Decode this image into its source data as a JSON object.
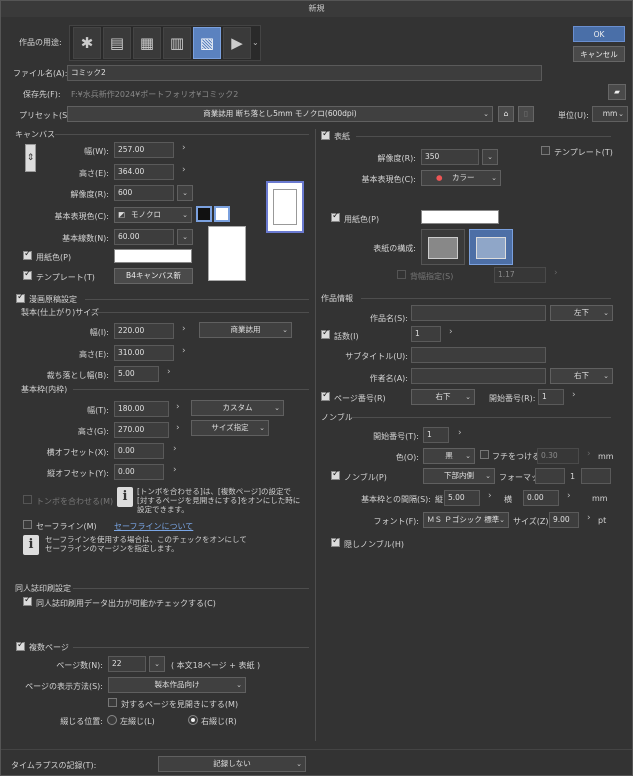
{
  "window": {
    "title": "新規"
  },
  "buttons": {
    "ok": "OK",
    "cancel": "キャンセル"
  },
  "purpose": {
    "label": "作品の用途:",
    "icons": [
      "illustration-icon",
      "webtoon-icon",
      "comic-icon",
      "book-icon",
      "comic-active-icon",
      "animation-icon"
    ]
  },
  "filename": {
    "label": "ファイル名(A):",
    "value": "コミック2"
  },
  "saveto": {
    "label": "保存先(F):",
    "value": "F:¥水兵新作2024¥ポートフォリオ¥コミック2"
  },
  "preset": {
    "label": "プリセット(S):",
    "value": "商業誌用 断ち落とし5mm モノクロ(600dpi)",
    "unit_label": "単位(U):",
    "unit": "mm"
  },
  "canvas": {
    "section": "キャンバス",
    "width_label": "幅(W):",
    "width": "257.00",
    "height_label": "高さ(E):",
    "height": "364.00",
    "res_label": "解像度(R):",
    "res": "600",
    "color_label": "基本表現色(C):",
    "color": "モノクロ",
    "lines_label": "基本線数(N):",
    "lines": "60.00",
    "paper_label": "用紙色(P)",
    "template_label": "テンプレート(T)",
    "template_value": "B4キャンバス新"
  },
  "manga": {
    "section": "漫画原稿設定",
    "finish_section": "製本(仕上がり)サイズ",
    "fw_label": "幅(I):",
    "fw": "220.00",
    "fw_preset": "商業誌用",
    "fh_label": "高さ(E):",
    "fh": "310.00",
    "bleed_label": "裁ち落とし幅(B):",
    "bleed": "5.00",
    "frame_section": "基本枠(内枠)",
    "bw_label": "幅(T):",
    "bw": "180.00",
    "bw_preset": "カスタム",
    "bh_label": "高さ(G):",
    "bh": "270.00",
    "bh_preset": "サイズ指定",
    "ox_label": "横オフセット(X):",
    "ox": "0.00",
    "oy_label": "縦オフセット(Y):",
    "oy": "0.00",
    "trim_label": "トンボを合わせる(M)",
    "trim_info1": "[トンボを合わせる]は、[複数ページ]の設定で",
    "trim_info2": "[対するページを見開きにする]をオンにした時に",
    "trim_info3": "設定できます。",
    "safe_label": "セーフライン(M)",
    "safe_link": "セーフラインについて",
    "safe_info1": "セーフラインを使用する場合は、このチェックをオンにして",
    "safe_info2": "セーフラインのマージンを指定します。"
  },
  "doujin": {
    "section": "同人誌印刷設定",
    "check_label": "同人誌印刷用データ出力が可能かチェックする(C)"
  },
  "multi": {
    "section": "複数ページ",
    "pages_label": "ページ数(N):",
    "pages": "22",
    "pages_note": "( 本文18ページ + 表紙 )",
    "view_label": "ページの表示方法(S):",
    "view": "製本作品向け",
    "spread_label": "対するページを見開きにする(M)",
    "bind_label": "綴じる位置:",
    "left_label": "左綴じ(L)",
    "right_label": "右綴じ(R)"
  },
  "timelapse": {
    "label": "タイムラプスの記録(T):",
    "value": "記録しない"
  },
  "cover": {
    "section": "表紙",
    "template_label": "テンプレート(T)",
    "res_label": "解像度(R):",
    "res": "350",
    "color_label": "基本表現色(C):",
    "color": "カラー",
    "paper_label": "用紙色(P)",
    "layout_label": "表紙の構成:",
    "spine_label": "背幅指定(S)",
    "spine": "1.17"
  },
  "info": {
    "section": "作品情報",
    "title_label": "作品名(S):",
    "title_pos": "左下",
    "episode_label": "話数(I)",
    "episode": "1",
    "subtitle_label": "サブタイトル(U):",
    "author_label": "作者名(A):",
    "author_pos": "右下",
    "pageno_label": "ページ番号(R)",
    "pageno_pos": "右下",
    "start_label": "開始番号(R):",
    "start": "1"
  },
  "nombre": {
    "section": "ノンブル",
    "start_label": "開始番号(T):",
    "start": "1",
    "color_label": "色(O):",
    "color": "黒",
    "border_label": "フチをつける(E):",
    "border": "0.30",
    "border_unit": "mm",
    "enable_label": "ノンブル(P)",
    "pos": "下部内側",
    "format_label": "フォーマット",
    "format_sep": "1",
    "gap_label": "基本枠との間隔(S):",
    "gap_v_label": "縦",
    "gap_v": "5.00",
    "gap_h_label": "横",
    "gap_h": "0.00",
    "gap_unit": "mm",
    "font_label": "フォント(F):",
    "font": "ＭＳ Ｐゴシック 標準",
    "size_label": "サイズ(Z):",
    "size": "9.00",
    "size_unit": "pt",
    "hidden_label": "隠しノンブル(H)"
  }
}
